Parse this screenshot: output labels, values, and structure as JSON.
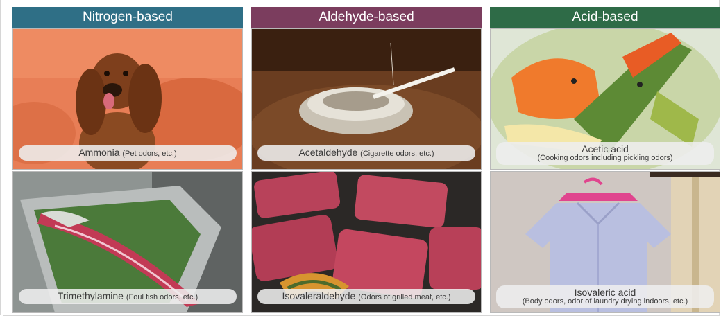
{
  "colors": {
    "nitrogen_header": "#2f6f86",
    "aldehyde_header": "#7b3d5e",
    "acid_header": "#2e6b47"
  },
  "columns": [
    {
      "header": "Nitrogen-based",
      "items": [
        {
          "name": "Ammonia",
          "note": "(Pet odors, etc.)",
          "image": "dachshund on orange sofa"
        },
        {
          "name": "Trimethylamine",
          "note": "(Foul fish odors, etc.)",
          "image": "fish skeleton in tray"
        }
      ]
    },
    {
      "header": "Aldehyde-based",
      "items": [
        {
          "name": "Acetaldehyde",
          "note": "(Cigarette odors, etc.)",
          "image": "glass ashtray with cigarette"
        },
        {
          "name": "Isovaleraldehyde",
          "note": "(Odors of grilled meat, etc.)",
          "image": "grilled meat slices"
        }
      ]
    },
    {
      "header": "Acid-based",
      "items": [
        {
          "name": "Acetic acid",
          "note": "(Cooking odors including pickling odors)",
          "image": "pickled vegetables"
        },
        {
          "name": "Isovaleric acid",
          "note": "(Body odors, odor of laundry drying indoors, etc.)",
          "image": "shirt on pink hanger"
        }
      ]
    }
  ]
}
